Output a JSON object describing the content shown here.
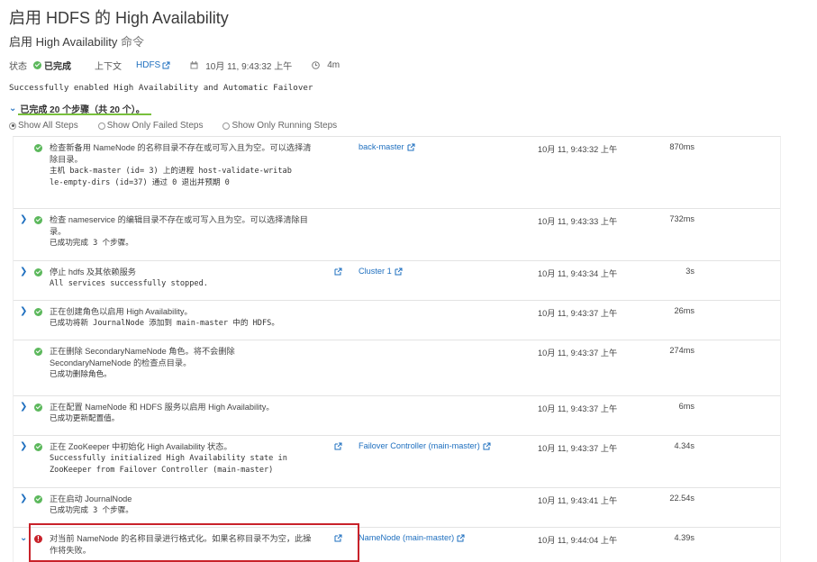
{
  "header": {
    "title": "启用 HDFS 的 High Availability",
    "subtitle_main": "启用 High Availability",
    "subtitle_suffix": "命令"
  },
  "status": {
    "label": "状态",
    "value": "已完成",
    "context_label": "上下文",
    "context_link": "HDFS",
    "date": "10月 11, 9:43:32 上午",
    "duration": "4m"
  },
  "summary": "Successfully enabled High Availability and Automatic Failover",
  "steps_toggle": "已完成 20 个步骤（共 20 个）。",
  "filters": [
    {
      "label": "Show All Steps",
      "selected": true
    },
    {
      "label": "Show Only Failed Steps",
      "selected": false
    },
    {
      "label": "Show Only Running Steps",
      "selected": false
    }
  ],
  "steps": [
    {
      "expand": false,
      "state": "success",
      "desc": [
        "检查新备用 NameNode 的名称目录不存在或可写入且为空。可以选择清",
        "除目录。"
      ],
      "mono": [
        "主机 back-master (id= 3) 上的进程 host-validate-writab",
        "le-empty-dirs (id=37) 通过 0 退出并预期 0"
      ],
      "row_link": false,
      "target": "back-master",
      "time": "10月 11, 9:43:32 上午",
      "duration": "870ms"
    },
    {
      "expand": true,
      "state": "success",
      "desc": [
        "检查 nameservice 的编辑目录不存在或可写入且为空。可以选择清除目",
        "录。"
      ],
      "mono": [
        "已成功完成 3 个步骤。"
      ],
      "row_link": false,
      "target": "",
      "time": "10月 11, 9:43:33 上午",
      "duration": "732ms"
    },
    {
      "expand": true,
      "state": "success",
      "desc": [
        "停止 hdfs 及其依赖服务"
      ],
      "mono": [
        "All services successfully stopped."
      ],
      "row_link": true,
      "target": "Cluster 1",
      "time": "10月 11, 9:43:34 上午",
      "duration": "3s"
    },
    {
      "expand": true,
      "state": "success",
      "desc": [
        "正在创建角色以启用 High Availability。"
      ],
      "mono": [
        "已成功将新 JournalNode 添加到 main-master 中的 HDFS。"
      ],
      "row_link": false,
      "target": "",
      "time": "10月 11, 9:43:37 上午",
      "duration": "26ms"
    },
    {
      "expand": false,
      "state": "success",
      "desc": [
        "正在删除 SecondaryNameNode 角色。将不会删除",
        "SecondaryNameNode 的检查点目录。"
      ],
      "mono": [
        "已成功删除角色。"
      ],
      "row_link": false,
      "target": "",
      "time": "10月 11, 9:43:37 上午",
      "duration": "274ms"
    },
    {
      "expand": true,
      "state": "success",
      "desc": [
        "正在配置 NameNode 和 HDFS 服务以启用 High Availability。"
      ],
      "mono": [
        "已成功更新配置值。"
      ],
      "row_link": false,
      "target": "",
      "time": "10月 11, 9:43:37 上午",
      "duration": "6ms"
    },
    {
      "expand": true,
      "state": "success",
      "desc": [
        "正在 ZooKeeper 中初始化 High Availability 状态。"
      ],
      "mono": [
        "Successfully initialized High Availability state in",
        "ZooKeeper from Failover Controller (main-master)"
      ],
      "row_link": true,
      "target": "Failover Controller (main-master)",
      "time": "10月 11, 9:43:37 上午",
      "duration": "4.34s"
    },
    {
      "expand": true,
      "state": "success",
      "desc": [
        "正在启动 JournalNode"
      ],
      "mono": [
        "已成功完成 3 个步骤。"
      ],
      "row_link": false,
      "target": "",
      "time": "10月 11, 9:43:41 上午",
      "duration": "22.54s"
    },
    {
      "expand": true,
      "state": "error",
      "desc": [
        "对当前 NameNode 的名称目录进行格式化。如果名称目录不为空，此操",
        "作将失败。"
      ],
      "mono": [],
      "row_link": true,
      "target": "NameNode (main-master)",
      "time": "10月 11, 9:44:04 上午",
      "duration": "4.39s"
    }
  ],
  "colors": {
    "link": "#1e6fbf",
    "success": "#5cb85c",
    "error": "#c8222a",
    "underline": "#78c03c"
  }
}
